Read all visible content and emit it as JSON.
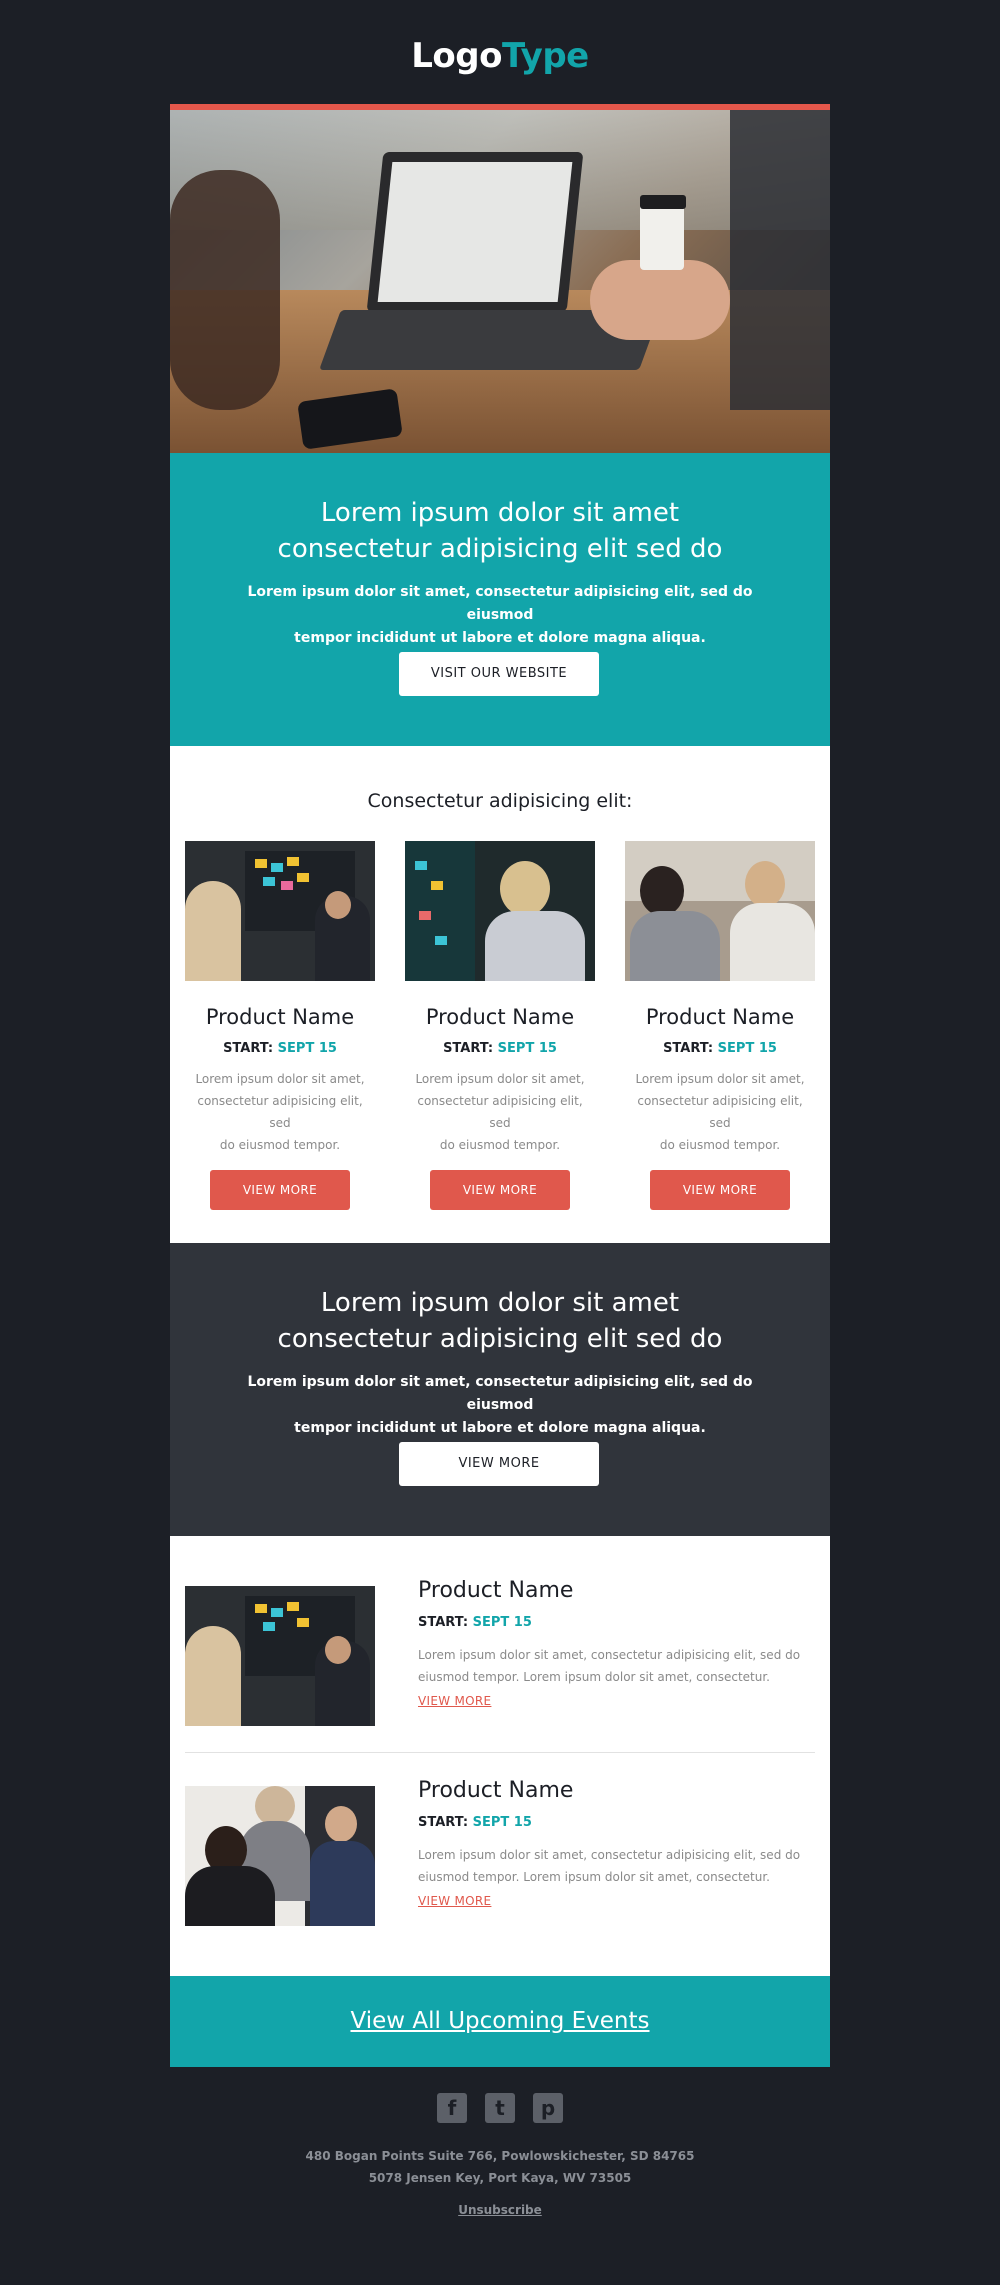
{
  "header": {
    "logo_part1": "Logo",
    "logo_part2": "Type"
  },
  "hero": {
    "image_alt": "laptop-on-desk-photo"
  },
  "intro": {
    "title_line1": "Lorem ipsum dolor sit amet",
    "title_line2": "consectetur adipisicing elit sed do",
    "text_line1": "Lorem ipsum dolor sit amet, consectetur adipisicing elit, sed do eiusmod",
    "text_line2": "tempor incididunt ut labore et dolore magna aliqua.",
    "button": "VISIT OUR WEBSITE"
  },
  "products": {
    "heading": "Consectetur adipisicing elit:",
    "items": [
      {
        "name": "Product Name",
        "start_label": "START:",
        "start_date": "SEPT 15",
        "desc_line1": "Lorem ipsum dolor sit amet,",
        "desc_line2": "consectetur adipisicing elit, sed",
        "desc_line3": "do eiusmod tempor.",
        "button": "VIEW MORE"
      },
      {
        "name": "Product Name",
        "start_label": "START:",
        "start_date": "SEPT 15",
        "desc_line1": "Lorem ipsum dolor sit amet,",
        "desc_line2": "consectetur adipisicing elit, sed",
        "desc_line3": "do eiusmod tempor.",
        "button": "VIEW MORE"
      },
      {
        "name": "Product Name",
        "start_label": "START:",
        "start_date": "SEPT 15",
        "desc_line1": "Lorem ipsum dolor sit amet,",
        "desc_line2": "consectetur adipisicing elit, sed",
        "desc_line3": "do eiusmod tempor.",
        "button": "VIEW MORE"
      }
    ]
  },
  "promo": {
    "title_line1": "Lorem ipsum dolor sit amet",
    "title_line2": "consectetur adipisicing elit sed do",
    "text_line1": "Lorem ipsum dolor sit amet, consectetur adipisicing elit, sed do eiusmod",
    "text_line2": "tempor incididunt ut labore et dolore magna aliqua.",
    "button": "VIEW MORE"
  },
  "list": [
    {
      "name": "Product Name",
      "start_label": "START:",
      "start_date": "SEPT 15",
      "desc_line1": "Lorem ipsum dolor sit amet, consectetur adipisicing elit, sed do",
      "desc_line2": "eiusmod tempor. Lorem ipsum dolor sit amet, consectetur.",
      "link": "VIEW MORE"
    },
    {
      "name": "Product Name",
      "start_label": "START:",
      "start_date": "SEPT 15",
      "desc_line1": "Lorem ipsum dolor sit amet, consectetur adipisicing elit, sed do",
      "desc_line2": "eiusmod tempor. Lorem ipsum dolor sit amet, consectetur.",
      "link": "VIEW MORE"
    }
  ],
  "cta": {
    "label": "View All Upcoming Events"
  },
  "footer": {
    "social": [
      {
        "icon": "facebook-icon",
        "glyph": "f"
      },
      {
        "icon": "twitter-icon",
        "glyph": "t"
      },
      {
        "icon": "pinterest-icon",
        "glyph": "p"
      }
    ],
    "address_line1": "480 Bogan Points Suite 766, Powlowskichester, SD 84765",
    "address_line2": "5078 Jensen Key, Port Kaya, WV 73505",
    "unsubscribe": "Unsubscribe"
  },
  "colors": {
    "background": "#1c1f26",
    "accent_teal": "#12a5aa",
    "accent_red": "#e0584c",
    "dark_panel": "#30343b"
  }
}
